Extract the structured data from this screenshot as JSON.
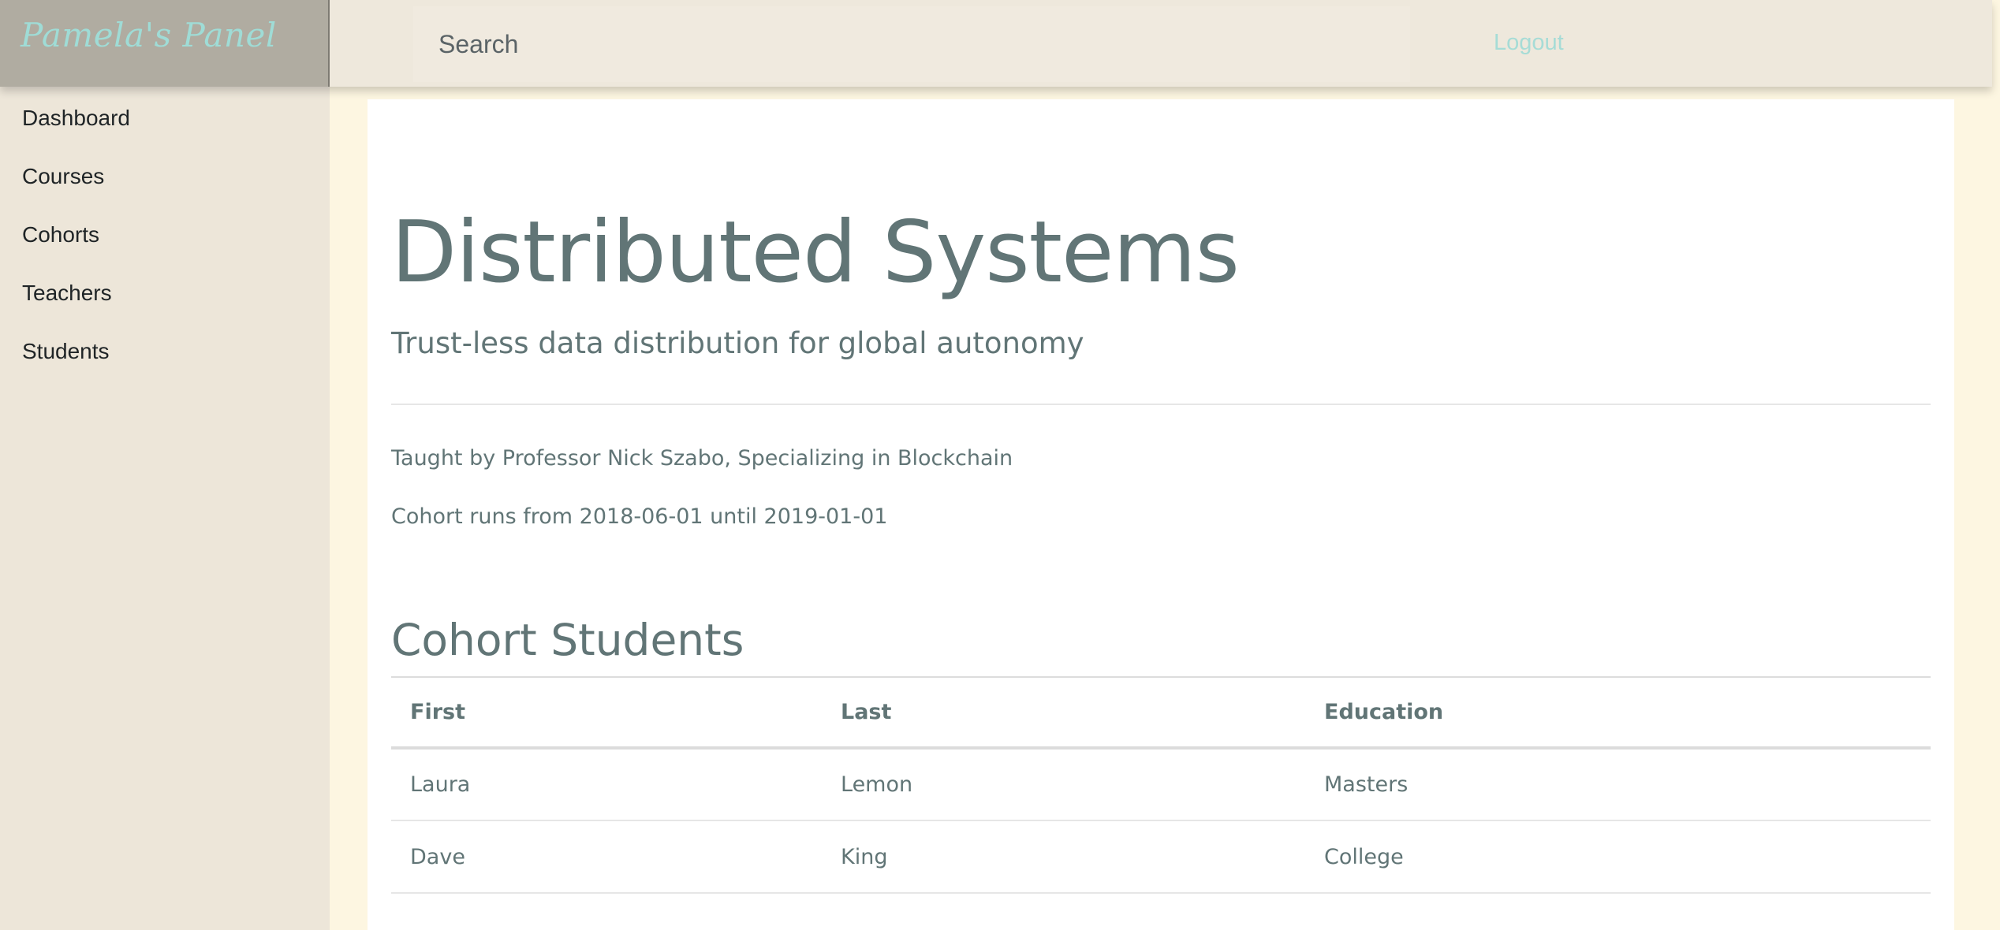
{
  "header": {
    "brand": "Pamela's Panel",
    "search_placeholder": "Search",
    "logout_label": "Logout"
  },
  "sidebar": {
    "items": [
      {
        "label": "Dashboard"
      },
      {
        "label": "Courses"
      },
      {
        "label": "Cohorts"
      },
      {
        "label": "Teachers"
      },
      {
        "label": "Students"
      }
    ]
  },
  "course": {
    "title": "Distributed Systems",
    "subtitle": "Trust-less data distribution for global autonomy",
    "teacher_line": "Taught by Professor Nick Szabo, Specializing in Blockchain",
    "cohort_line": "Cohort runs from 2018-06-01 until 2019-01-01"
  },
  "students_section": {
    "title": "Cohort Students",
    "columns": [
      "First",
      "Last",
      "Education"
    ],
    "rows": [
      [
        "Laura",
        "Lemon",
        "Masters"
      ],
      [
        "Dave",
        "King",
        "College"
      ]
    ]
  },
  "colors": {
    "brand_text": "#9fdcd6",
    "accent_link": "#a6dcd6",
    "heading_text": "#617576",
    "page_background": "#fdf6e1"
  }
}
